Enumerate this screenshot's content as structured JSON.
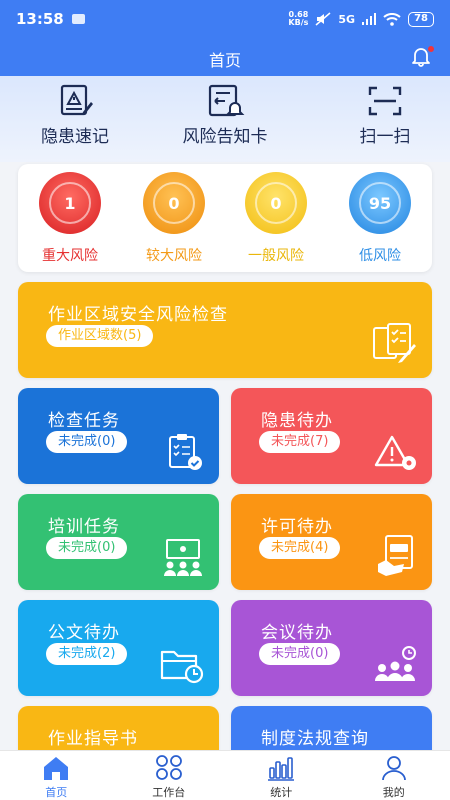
{
  "status": {
    "time": "13:58",
    "speed_value": "0.68",
    "speed_unit": "KB/s",
    "network": "5G",
    "battery": "78"
  },
  "header": {
    "title": "首页"
  },
  "quick_actions": [
    {
      "label": "隐患速记",
      "icon": "report-icon"
    },
    {
      "label": "风险告知卡",
      "icon": "notice-card-icon"
    },
    {
      "label": "扫一扫",
      "icon": "scan-icon"
    }
  ],
  "risk_levels": [
    {
      "value": "1",
      "label": "重大风险",
      "color": "#e63232"
    },
    {
      "value": "0",
      "label": "较大风险",
      "color": "#f39a17"
    },
    {
      "value": "0",
      "label": "一般风险",
      "color": "#f2c419"
    },
    {
      "value": "95",
      "label": "低风险",
      "color": "#2f8fe6"
    }
  ],
  "tiles": [
    {
      "title": "作业区域安全风险检查",
      "badge": "作业区域数(5)",
      "color": "#f9b714"
    },
    {
      "title": "检查任务",
      "badge": "未完成(0)",
      "color": "#1b73d8"
    },
    {
      "title": "隐患待办",
      "badge": "未完成(7)",
      "color": "#f45659"
    },
    {
      "title": "培训任务",
      "badge": "未完成(0)",
      "color": "#33c173"
    },
    {
      "title": "许可待办",
      "badge": "未完成(4)",
      "color": "#fb9513"
    },
    {
      "title": "公文待办",
      "badge": "未完成(2)",
      "color": "#18a9ee"
    },
    {
      "title": "会议待办",
      "badge": "未完成(0)",
      "color": "#a855d6"
    },
    {
      "title": "作业指导书",
      "color": "#f9b714"
    },
    {
      "title": "制度法规查询",
      "color": "#3f7df3"
    }
  ],
  "tabs": [
    {
      "label": "首页",
      "active": true
    },
    {
      "label": "工作台"
    },
    {
      "label": "统计"
    },
    {
      "label": "我的"
    }
  ]
}
